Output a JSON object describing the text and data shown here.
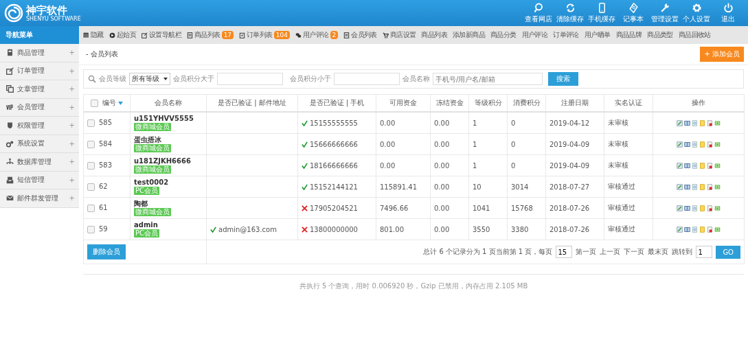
{
  "brand": {
    "name": "神宇软件",
    "subtitle": "SHENYU SOFTWARE"
  },
  "header_actions": [
    {
      "label": "查看网店",
      "kind": "search"
    },
    {
      "label": "清除缓存",
      "kind": "refresh"
    },
    {
      "label": "手机缓存",
      "kind": "phone"
    },
    {
      "label": "记事本",
      "kind": "note"
    },
    {
      "label": "管理设置",
      "kind": "wrench"
    },
    {
      "label": "个人设置",
      "kind": "gear"
    },
    {
      "label": "退出",
      "kind": "power"
    }
  ],
  "sidebar": {
    "title": "导航菜单",
    "items": [
      {
        "label": "商品管理",
        "kind": "box"
      },
      {
        "label": "订单管理",
        "kind": "edit"
      },
      {
        "label": "文章管理",
        "kind": "copy"
      },
      {
        "label": "会员管理",
        "kind": "vip"
      },
      {
        "label": "权限管理",
        "kind": "shield"
      },
      {
        "label": "系统设置",
        "kind": "gears"
      },
      {
        "label": "数据库管理",
        "kind": "tree"
      },
      {
        "label": "短信管理",
        "kind": "inbox"
      },
      {
        "label": "邮件群发管理",
        "kind": "mail"
      }
    ],
    "expand_mark": "+"
  },
  "tabs": [
    {
      "label": "隐藏",
      "kind": "bars"
    },
    {
      "label": "起始页",
      "kind": "play"
    },
    {
      "label": "设置导航栏",
      "kind": "edit"
    },
    {
      "label": "商品列表",
      "kind": "list",
      "badge": "17"
    },
    {
      "label": "订单列表",
      "kind": "clip",
      "badge": "104"
    },
    {
      "label": "用户评论",
      "kind": "chat",
      "badge": "2"
    },
    {
      "label": "会员列表",
      "kind": "list"
    },
    {
      "label": "商店设置",
      "kind": "cart"
    }
  ],
  "quick_links": [
    "商品列表",
    "添加新商品",
    "商品分类",
    "用户评论",
    "订单评论",
    "用户晒单",
    "商品品牌",
    "商品类型",
    "商品回收站"
  ],
  "page_title": "- 会员列表",
  "add_button": "+ 添加会员",
  "search": {
    "level_label": "会员等级",
    "level_value": "所有等级",
    "min_label": "会员积分大于",
    "max_label": "会员积分小于",
    "name_label": "会员名称",
    "name_placeholder": "手机号/用户名/邮箱",
    "button": "搜索"
  },
  "table": {
    "columns": [
      "编号",
      "会员名称",
      "是否已验证 | 邮件地址",
      "是否已验证 | 手机",
      "可用资金",
      "冻结资金",
      "等级积分",
      "消费积分",
      "注册日期",
      "实名认证",
      "操作"
    ],
    "rows": [
      {
        "id": "585",
        "name": "u151YHVV5555",
        "tag": "微商城会员",
        "phone_verified": true,
        "phone": "15155555555",
        "funds": "0.00",
        "frozen": "0.00",
        "level_points": "1",
        "spend_points": "0",
        "date": "2019-04-12",
        "realname": "未审核",
        "checked": false
      },
      {
        "id": "584",
        "name": "蛋虫捂冰",
        "tag": "微商城会员",
        "phone_verified": true,
        "phone": "15666666666",
        "funds": "0.00",
        "frozen": "0.00",
        "level_points": "1",
        "spend_points": "0",
        "date": "2019-04-09",
        "realname": "未审核",
        "checked": false
      },
      {
        "id": "583",
        "name": "u181ZJKH6666",
        "tag": "微商城会员",
        "phone_verified": true,
        "phone": "18166666666",
        "funds": "0.00",
        "frozen": "0.00",
        "level_points": "1",
        "spend_points": "0",
        "date": "2019-04-09",
        "realname": "未审核",
        "checked": false
      },
      {
        "id": "62",
        "name": "test0002",
        "tag": "PC会员",
        "phone_verified": true,
        "phone": "15152144121",
        "funds": "115891.41",
        "frozen": "0.00",
        "level_points": "10",
        "spend_points": "3014",
        "date": "2018-07-27",
        "realname": "审核通过",
        "checked": false
      },
      {
        "id": "61",
        "name": "陶都",
        "tag": "微商城会员",
        "phone_verified": false,
        "phone": "17905204521",
        "funds": "7496.66",
        "frozen": "0.00",
        "level_points": "1041",
        "spend_points": "15768",
        "date": "2018-07-26",
        "realname": "审核通过",
        "checked": false
      },
      {
        "id": "59",
        "name": "admin",
        "tag": "PC会员",
        "email_verified": true,
        "email": "admin@163.com",
        "phone_verified": false,
        "phone": "13800000000",
        "funds": "801.00",
        "frozen": "0.00",
        "level_points": "3550",
        "spend_points": "3380",
        "date": "2018-07-26",
        "realname": "审核通过",
        "checked": false
      }
    ]
  },
  "delete_button": "删除会员",
  "pagination": {
    "summary": "总计 6 个记录分为 1 页当前第 1 页，每页",
    "per_page": "15",
    "links": [
      "第一页",
      "上一页",
      "下一页",
      "最末页"
    ],
    "jump_label": "跳转到",
    "jump_value": "1",
    "go": "GO"
  },
  "footer": "共执行 5 个查询，用时 0.006920 秒，Gzip 已禁用，内存占用 2.105 MB"
}
